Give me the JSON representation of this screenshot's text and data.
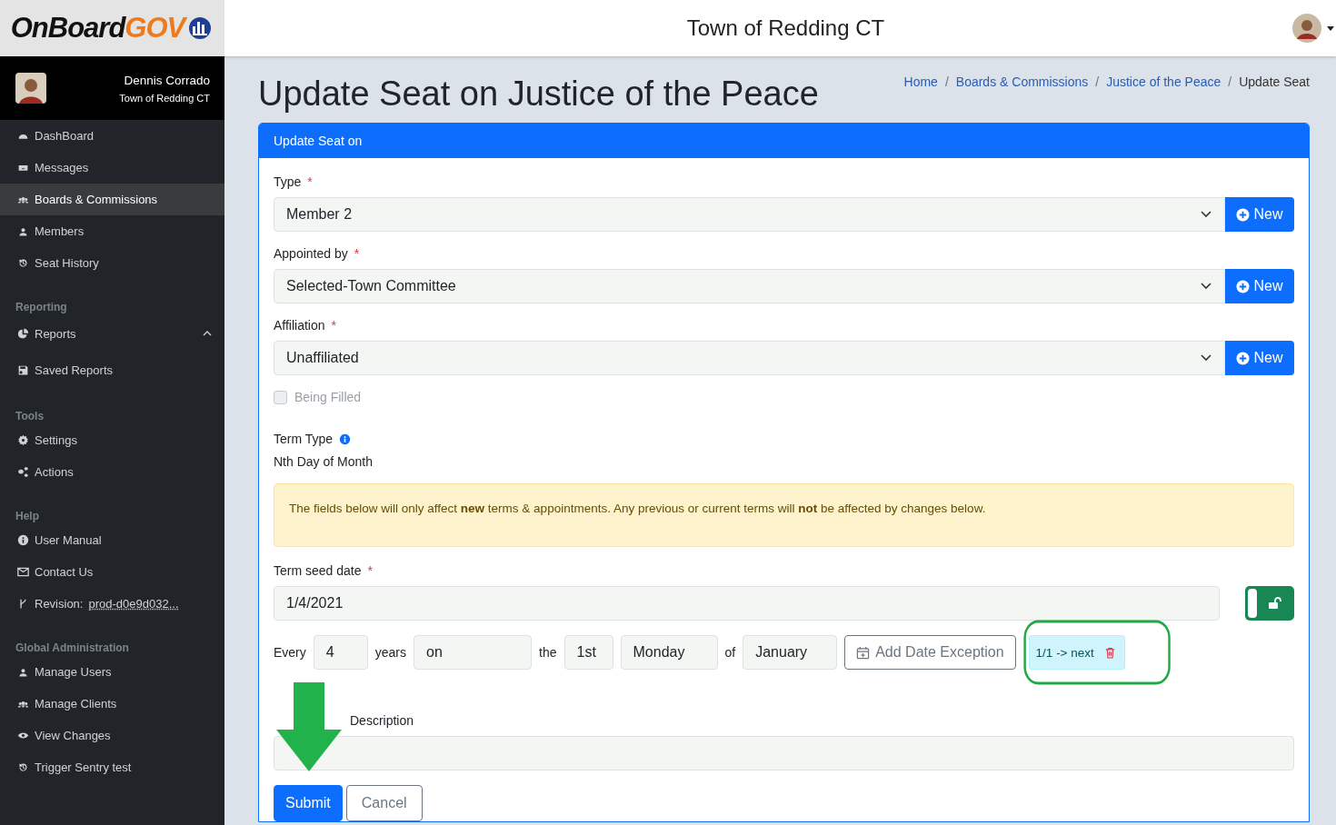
{
  "header": {
    "logo": {
      "part_1": "OnBoard",
      "part_2": "GOV"
    },
    "title": "Town of Redding CT"
  },
  "sidebar": {
    "user": {
      "name": "Dennis Corrado",
      "org": "Town of Redding CT"
    },
    "sections": [
      {
        "items": [
          {
            "label": "DashBoard",
            "selected": false
          },
          {
            "label": "Messages",
            "selected": false
          },
          {
            "label": "Boards & Commissions",
            "selected": true
          },
          {
            "label": "Members",
            "selected": false
          },
          {
            "label": "Seat History",
            "selected": false
          }
        ]
      },
      {
        "heading": "Reporting",
        "items": [
          {
            "label": "Reports",
            "selected": false,
            "expanded": true
          },
          {
            "label": "Saved Reports",
            "selected": false
          }
        ]
      },
      {
        "heading": "Tools",
        "items": [
          {
            "label": "Settings",
            "selected": false
          },
          {
            "label": "Actions",
            "selected": false
          }
        ]
      },
      {
        "heading": "Help",
        "items": [
          {
            "label": "User Manual",
            "selected": false
          },
          {
            "label": "Contact Us",
            "selected": false
          },
          {
            "label": "Revision:",
            "link": "prod-d0e9d032...",
            "selected": false
          }
        ]
      },
      {
        "heading": "Global Administration",
        "items": [
          {
            "label": "Manage Users",
            "selected": false
          },
          {
            "label": "Manage Clients",
            "selected": false
          },
          {
            "label": "View Changes",
            "selected": false
          },
          {
            "label": "Trigger Sentry test",
            "selected": false
          }
        ]
      }
    ]
  },
  "page_title": "Update Seat on Justice of the Peace",
  "breadcrumb": [
    {
      "label": "Home",
      "link": true
    },
    {
      "separator": "/",
      "label": "Boards & Commissions",
      "link": true
    },
    {
      "separator": "/",
      "label": "Justice of the Peace",
      "link": true
    },
    {
      "separator": "/",
      "label": "Update Seat",
      "link": false
    }
  ],
  "card": {
    "title": "Update Seat on",
    "fields": [
      {
        "kind": "select",
        "label": "Type",
        "required_mark": "*",
        "value": "Member 2",
        "button": "New"
      },
      {
        "kind": "select",
        "label": "Appointed by",
        "required_mark": "*",
        "value": "Selected-Town Committee",
        "button": "New"
      },
      {
        "kind": "select",
        "label": "Affiliation",
        "required_mark": "*",
        "value": "Unaffiliated",
        "button": "New"
      },
      {
        "kind": "checkbox",
        "label": "Being Filled",
        "checked": false,
        "disabled": true
      },
      {
        "kind": "info",
        "label": "Term Type",
        "value": "Nth Day of Month"
      },
      {
        "kind": "alert",
        "text": "The fields below will only affect **new** terms & appointments. Any previous or current terms will **not** be affected by changes below."
      },
      {
        "kind": "date",
        "label": "Term seed date",
        "required_mark": "*",
        "value": "1/4/2021",
        "locked": false
      },
      {
        "kind": "recurrence",
        "every": "Every",
        "years_value": "4",
        "years": "years",
        "on_value": "on",
        "the": "the",
        "ordinal": "1st",
        "weekday": "Monday",
        "of": "of",
        "month": "January",
        "add_button": "Add Date Exception",
        "exceptions": [
          "1/1 -> next"
        ]
      },
      {
        "kind": "text",
        "label": "Description"
      }
    ],
    "buttons": [
      {
        "label": "Submit",
        "primary": true
      },
      {
        "label": "Cancel",
        "primary": false
      }
    ]
  }
}
